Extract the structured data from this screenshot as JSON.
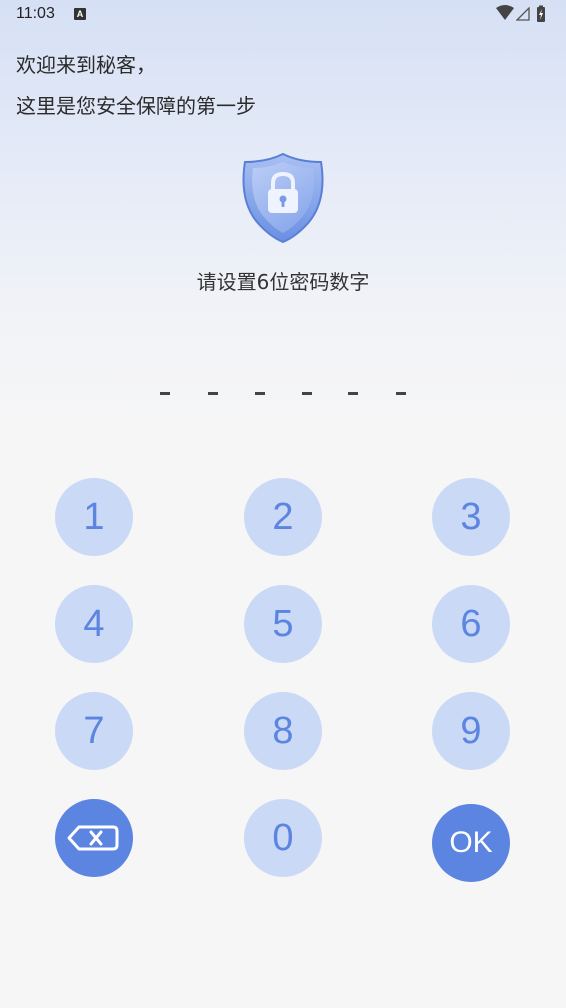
{
  "status_bar": {
    "time": "11:03",
    "notification_icon": "A",
    "icons": [
      "wifi-icon",
      "signal-icon",
      "battery-icon"
    ]
  },
  "greeting": {
    "line1": "欢迎来到秘客，",
    "line2": "这里是您安全保障的第一步"
  },
  "shield_icon": "shield-lock-icon",
  "prompt": "请设置6位密码数字",
  "pin": {
    "length": 6,
    "entered": 0,
    "placeholder_char": "-"
  },
  "keypad": {
    "key1": "1",
    "key2": "2",
    "key3": "3",
    "key4": "4",
    "key5": "5",
    "key6": "6",
    "key7": "7",
    "key8": "8",
    "key9": "9",
    "key0": "0",
    "ok": "OK",
    "backspace_icon": "backspace-icon"
  },
  "colors": {
    "accent": "#5b85e0",
    "key_background": "#cad9f5",
    "header_gradient_top": "#d6e0f5",
    "page_background": "#f6f6f6"
  }
}
